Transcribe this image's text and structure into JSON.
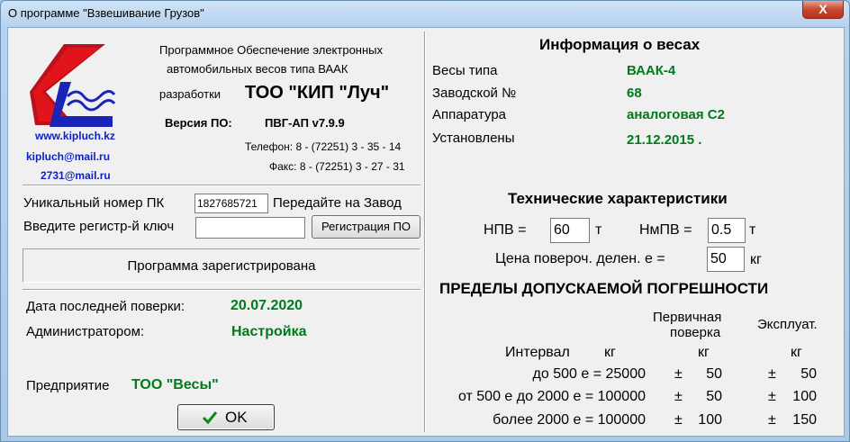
{
  "window": {
    "title": "О программе \"Взвешивание Грузов\"",
    "close_label": "X"
  },
  "about": {
    "line1": "Программное Обеспечение электронных",
    "line2": "автомобильных весов типа ВААК",
    "developer_label": "разработки",
    "developer_name": "ТОО \"КИП \"Луч\"",
    "version_label": "Версия ПО:",
    "version_value": "ПВГ-АП  v7.9.9",
    "phone": "Телефон: 8 - (72251)  3 - 35 - 14",
    "fax": "Факс: 8 - (72251)  3 - 27 - 31",
    "site": "www.kipluch.kz",
    "email1": "kipluch@mail.ru",
    "email2": "2731@mail.ru"
  },
  "registration": {
    "pc_id_label": "Уникальный номер ПК",
    "pc_id_value": "1827685721",
    "send_label": "Передайте на Завод",
    "key_label": "Введите регистр-й ключ",
    "key_value": "",
    "register_button": "Регистрация ПО",
    "status": "Программа зарегистрирована"
  },
  "verification": {
    "date_label": "Дата последней поверки:",
    "date_value": "20.07.2020",
    "admin_label": "Администратором:",
    "admin_value": "Настройка",
    "company_label": "Предприятие",
    "company_value": "ТОО \"Весы\""
  },
  "ok_button": "OK",
  "scale_info": {
    "heading": "Информация о весах",
    "type_label": "Весы типа",
    "type_value": "ВААК-4",
    "serial_label": "Заводской №",
    "serial_value": "68",
    "hw_label": "Аппаратура",
    "hw_value": "аналоговая С2",
    "installed_label": "Установлены",
    "installed_value": "21.12.2015 ."
  },
  "specs": {
    "heading": "Технические характеристики",
    "npv_label": "НПВ =",
    "npv_value": "60",
    "npv_unit": "т",
    "nmpv_label": "НмПВ =",
    "nmpv_value": "0.5",
    "nmpv_unit": "т",
    "div_label": "Цена повероч. делен. е =",
    "div_value": "50",
    "div_unit": "кг"
  },
  "errors": {
    "heading": "ПРЕДЕЛЫ ДОПУСКАЕМОЙ ПОГРЕШНОСТИ",
    "col_primary_1": "Первичная",
    "col_primary_2": "поверка",
    "col_exploit": "Эксплуат.",
    "interval_label": "Интервал",
    "unit_interval": "кг",
    "unit_primary": "кг",
    "unit_exploit": "кг",
    "rows": [
      {
        "interval": "до 500 е = 25000",
        "primary_sign": "±",
        "primary": "50",
        "exploit_sign": "±",
        "exploit": "50"
      },
      {
        "interval": "от 500 е до 2000 е = 100000",
        "primary_sign": "±",
        "primary": "50",
        "exploit_sign": "±",
        "exploit": "100"
      },
      {
        "interval": "более 2000 е = 100000",
        "primary_sign": "±",
        "primary": "100",
        "exploit_sign": "±",
        "exploit": "150"
      }
    ]
  },
  "icons": {
    "ok": "check-icon",
    "close": "close-icon",
    "logo": "company-logo"
  },
  "colors": {
    "value_green": "#007a1a",
    "link_blue": "#0b1fc8",
    "logo_red": "#e1141c"
  }
}
